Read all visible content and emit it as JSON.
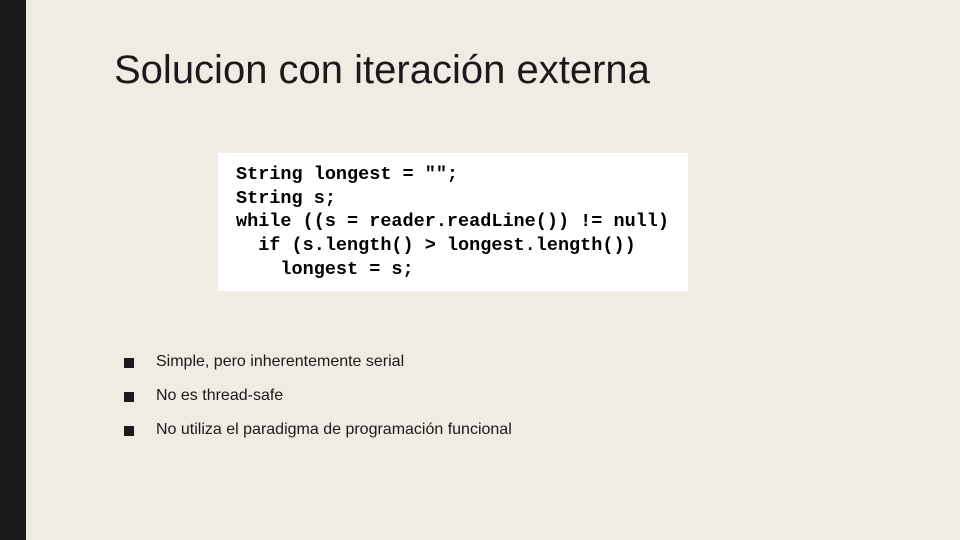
{
  "slide": {
    "title": "Solucion con iteración externa",
    "code": "String longest = \"\";\nString s;\nwhile ((s = reader.readLine()) != null)\n  if (s.length() > longest.length())\n    longest = s;",
    "bullets": [
      "Simple, pero inherentemente serial",
      "No es thread-safe",
      "No utiliza el paradigma de programación funcional"
    ]
  }
}
